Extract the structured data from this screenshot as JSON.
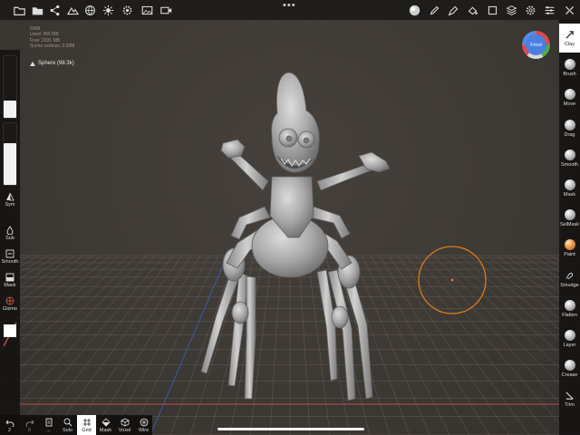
{
  "stats": {
    "lines": [
      "RAM",
      "Used: 456 MB",
      "Free: 2231 MB",
      "Scene vertices: 2.93M"
    ]
  },
  "mesh": {
    "name": "Sphere (98.3k)"
  },
  "gizmo": {
    "label": "Front"
  },
  "top_toolbar": {
    "left_icons": [
      "folder-icon",
      "share-icon",
      "scene-icon",
      "globe-icon",
      "sun-icon",
      "settings-icon",
      "image-icon",
      "video-icon"
    ],
    "menu_glyph": "•••",
    "right_icons": [
      "material-sphere-icon",
      "pen-icon",
      "eyedropper-icon",
      "paint-bucket-icon",
      "square-icon",
      "layers-icon",
      "gear-icon",
      "sliders-icon",
      "tools-icon"
    ]
  },
  "left_panel": {
    "radius_slider_value": 0.28,
    "intensity_slider_value": 0.68,
    "items": [
      {
        "label": "Sym",
        "icon": "symmetry-icon"
      },
      {
        "label": "Sub",
        "icon": "sub-icon"
      },
      {
        "label": "Smooth",
        "icon": "smooth-icon"
      },
      {
        "label": "Mask",
        "icon": "mask-icon"
      },
      {
        "label": "Gizmo",
        "icon": "gizmo-icon"
      }
    ]
  },
  "right_panel": {
    "tools": [
      {
        "label": "Clay",
        "active": true,
        "style": "glyph",
        "icon": "clay-icon"
      },
      {
        "label": "Brush",
        "style": "ball"
      },
      {
        "label": "Move",
        "style": "ball"
      },
      {
        "label": "Drag",
        "style": "ball"
      },
      {
        "label": "Smooth",
        "style": "ball"
      },
      {
        "label": "Mask",
        "style": "ball"
      },
      {
        "label": "SelMask",
        "style": "ball"
      },
      {
        "label": "Paint",
        "style": "orange"
      },
      {
        "label": "Smudge",
        "style": "glyph",
        "icon": "smudge-icon"
      },
      {
        "label": "Flatten",
        "style": "ball"
      },
      {
        "label": "Layer",
        "style": "ball"
      },
      {
        "label": "Crease",
        "style": "ball"
      },
      {
        "label": "Trim",
        "style": "glyph",
        "icon": "trim-icon"
      }
    ]
  },
  "bottom_toolbar": {
    "items": [
      {
        "label": "2",
        "icon": "undo-icon"
      },
      {
        "label": "0",
        "icon": "redo-icon"
      },
      {
        "label": "...",
        "icon": "clipboard-icon"
      },
      {
        "label": "Solo",
        "icon": "magnifier-icon"
      },
      {
        "label": "Grid",
        "icon": "grid-icon",
        "active": true
      },
      {
        "label": "Mask",
        "icon": "mask-view-icon"
      },
      {
        "label": "Voxel",
        "icon": "voxel-icon"
      },
      {
        "label": "Wire",
        "icon": "wire-icon"
      }
    ]
  },
  "colors": {
    "background": "#3d3935",
    "panel": "#161514",
    "brush_cursor": "#e07a1c",
    "model": "#b8b8b8",
    "grid_line": "#6b6560",
    "grid_red": "#c24a4a",
    "grid_blue": "#3a64b8"
  }
}
